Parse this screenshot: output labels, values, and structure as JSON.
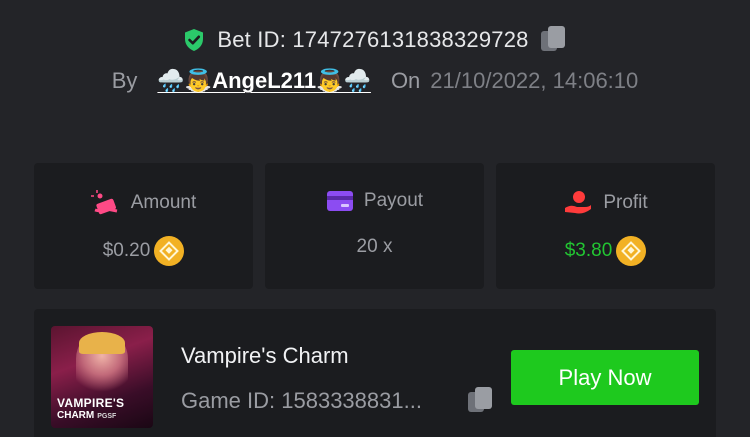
{
  "bet": {
    "id_label": "Bet ID: 1747276131838329728",
    "by_label": "By",
    "user": "🌧️👼AngeL211👼🌧️",
    "on_label": "On",
    "date": "21/10/2022, 14:06:10"
  },
  "stats": [
    {
      "label": "Amount",
      "value": "$0.20",
      "icon": "bet-amount-icon",
      "value_color": "#9b9da3"
    },
    {
      "label": "Payout",
      "value": "20 x",
      "icon": "payout-card-icon",
      "value_color": "#9b9da3"
    },
    {
      "label": "Profit",
      "value": "$3.80",
      "icon": "profit-hand-icon",
      "value_color": "#22c532"
    }
  ],
  "game": {
    "thumb_title": "VAMPIRE'S",
    "thumb_sub": "CHARM",
    "thumb_brand": "PGSF",
    "title": "Vampire's Charm",
    "id_label": "Game ID: 1583338831...",
    "play_label": "Play Now"
  },
  "colors": {
    "background": "#232428",
    "card": "#1b1c1f",
    "shield": "#2bc96a",
    "amount_icon": "#ff4a86",
    "payout_icon": "#8c4cf2",
    "profit_icon": "#ff3b3b",
    "profit_value": "#22c532",
    "play_button": "#1ec91e",
    "coin": "#f2b124"
  }
}
